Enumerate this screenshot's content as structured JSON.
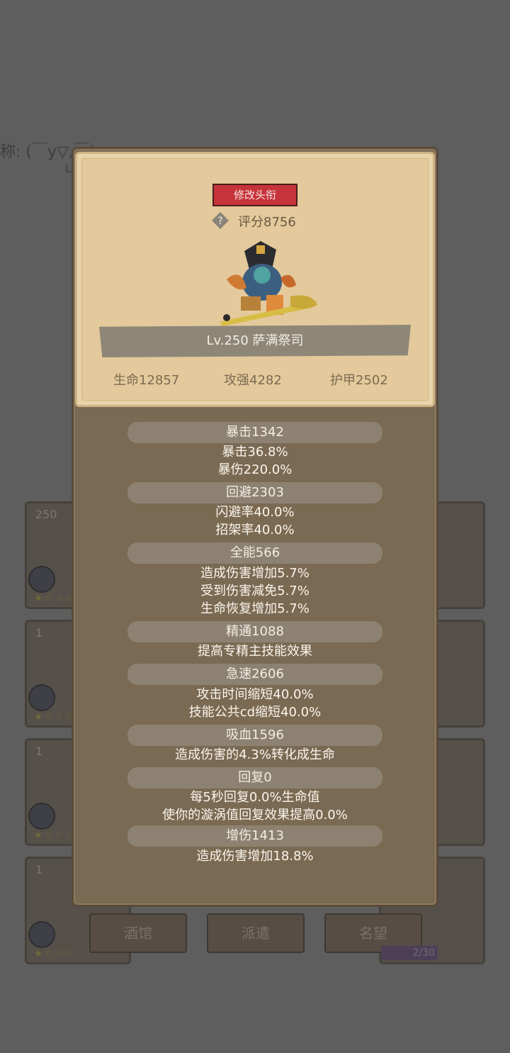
{
  "background": {
    "nickname_fragment": "称: (￣y▽,￣)",
    "nickname_sub": "L",
    "cards": [
      {
        "level": "250"
      },
      {
        "level": "1"
      },
      {
        "level": "1"
      },
      {
        "level": "1"
      }
    ],
    "buttons": [
      "酒馆",
      "派遣",
      "名望"
    ],
    "progress_text": "2/30"
  },
  "panel": {
    "title_button": "修改头衔",
    "help_icon": "?",
    "score": "评分8756",
    "hero_name": "Lv.250 萨满祭司",
    "base_stats": {
      "hp": "生命12857",
      "attack": "攻强4282",
      "armor": "护甲2502"
    },
    "stat_groups": [
      {
        "head": "暴击1342",
        "lines": [
          "暴击36.8%",
          "暴伤220.0%"
        ]
      },
      {
        "head": "回避2303",
        "lines": [
          "闪避率40.0%",
          "招架率40.0%"
        ]
      },
      {
        "head": "全能566",
        "lines": [
          "造成伤害增加5.7%",
          "受到伤害减免5.7%",
          "生命恢复增加5.7%"
        ]
      },
      {
        "head": "精通1088",
        "lines": [
          "提高专精主技能效果"
        ]
      },
      {
        "head": "急速2606",
        "lines": [
          "攻击时间缩短40.0%",
          "技能公共cd缩短40.0%"
        ]
      },
      {
        "head": "吸血1596",
        "lines": [
          "造成伤害的4.3%转化成生命"
        ]
      },
      {
        "head": "回复0",
        "lines": [
          "每5秒回复0.0%生命值",
          "使你的漩涡值回复效果提高0.0%"
        ]
      },
      {
        "head": "增伤1413",
        "lines": [
          "造成伤害增加18.8%"
        ]
      }
    ]
  }
}
